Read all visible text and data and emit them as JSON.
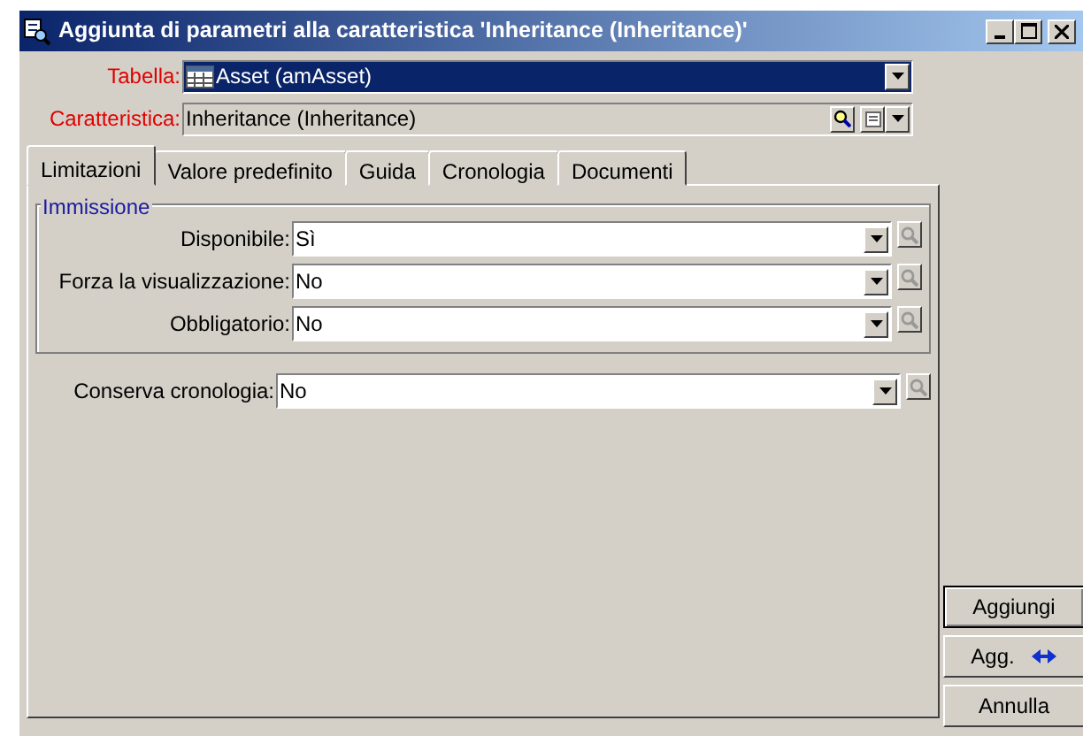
{
  "window": {
    "title": "Aggiunta di parametri alla caratteristica 'Inheritance (Inheritance)'"
  },
  "header_fields": [
    {
      "label": "Tabella:",
      "value": "Asset (amAsset)",
      "kind": "table",
      "selected": true
    },
    {
      "label": "Caratteristica:",
      "value": "Inheritance (Inheritance)",
      "kind": "lookup",
      "selected": false
    }
  ],
  "tabs": [
    {
      "label": "Limitazioni",
      "selected": true
    },
    {
      "label": "Valore predefinito",
      "selected": false
    },
    {
      "label": "Guida",
      "selected": false
    },
    {
      "label": "Cronologia",
      "selected": false
    },
    {
      "label": "Documenti",
      "selected": false
    }
  ],
  "group": {
    "title": "Immissione",
    "fields": [
      {
        "label": "Disponibile:",
        "value": "Sì"
      },
      {
        "label": "Forza la visualizzazione:",
        "value": "No"
      },
      {
        "label": "Obbligatorio:",
        "value": "No"
      }
    ]
  },
  "fields": [
    {
      "label": "Conserva cronologia:",
      "value": "No"
    }
  ],
  "buttons": [
    {
      "label": "Aggiungi",
      "kind": "plain"
    },
    {
      "label": "Agg.",
      "kind": "with-icon"
    },
    {
      "label": "Annulla",
      "kind": "plain"
    }
  ]
}
